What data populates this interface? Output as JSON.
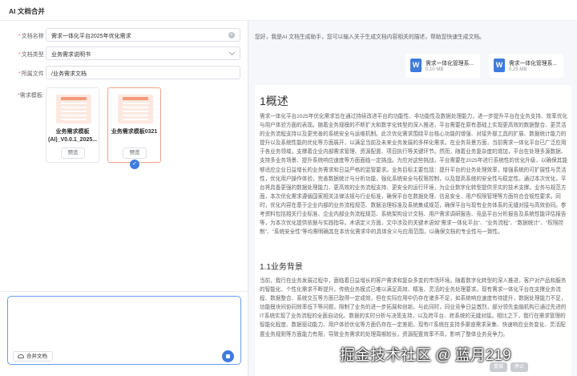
{
  "app": {
    "title": "AI 文档合并"
  },
  "form": {
    "doc_name": {
      "label": "文档名称",
      "value": "需求一体化平台2025年优化需求"
    },
    "doc_type": {
      "label": "文档类型",
      "value": "业务需求说明书"
    },
    "folder": {
      "label": "所属文件",
      "value": "/业务需求文档"
    },
    "template_label": "需求模板:"
  },
  "templates": [
    {
      "name": "业务需求模板(AI)_V0.0.1_2025...",
      "preview_label": "预览",
      "selected": false
    },
    {
      "name": "业务需求模板0321",
      "preview_label": "预览",
      "selected": true
    }
  ],
  "composer": {
    "merge_button": "合并文档"
  },
  "assistant": {
    "intro": "您好，我是AI 文档生成助手，您可以输入关于生成文档内容相关的描述，帮助您快速生成文档。",
    "files": [
      {
        "name": "需求一体化管理系...",
        "size": "0.10 MB",
        "icon": "word-icon"
      },
      {
        "name": "需求一体化管理系...",
        "size": "0.25 MB",
        "icon": "word-icon"
      }
    ]
  },
  "document": {
    "h1": "1概述",
    "p1": "需求一体化平台2025年优化需求旨在通过持续改进平台的功能性、非功能性及数据处理能力，进一步提升平台在业务支持、效率优化与用户体验方面的表现。随着业务规模的不断扩大和数字化转型的深入推进，平台需要在原有基础上实现更高效的数据整合、更灵活的业务流程支持以及更完善的系统安全与运维机制。此次优化需求围绕平台核心功能的增强、对接外部工具的扩展、数据统计能力的提升以及系统性能的优化等方面展开，以满足当前及未来业务发展的多样化需求。在业务背景方面，当前需求一体化平台已广泛应用于各业务领域，支撑着企业内部需求管理、资源配置、项目执行等关键环节。然而，随着业务复杂度的增加，平台在处理多源数据、支持多业务场景、提升系统响应速度等方面面临一定挑战。为应对这些挑战，平台需要在2025年进行系统性的优化升级，以确保其能够适应企业日益增长的业务需求和日益严格的监管要求。业务目标主要包括：提升平台的业务处理效率，增强系统的可扩展性与灵活性，优化用户操作体验，完善数据统计与分析功能，强化系统安全与权限控制，以及提高系统的安全性与稳定性。通过本次优化，平台将具备更强的数据处理能力、更高效的业务流程支持、更安全的运行环境，为企业数字化转型提供坚实的技术支撑。业务与规范方面，本次优化需求遵循国家相关法律法规与行业标准，确保平台在数据处理、信息安全、用户权限管理等方面符合合规性要求。同时，优化内容在基于企业内部的业务流程规范、数据治理标准及系统集成规范，确保平台与现有业务体系的无缝对接与高效协同。参考资料包括相关行业标准、企业内部业务流程规范、系统架构设计文档、用户需求调研报告、竞品平台分析报告及系统性能评估报告等，为本次优化提供依据与实践指导。术语定义方面，文中涉及的关键术语如\"需求一体化平台\"、\"业务流程\"、\"数据统计\"、\"权限控制\"、\"系统安全性\"等均需明确其在本优化需求中的具体含义与应用范围，以确保文档的专业性与一致性。",
    "h2": "1.1业务背景",
    "p2": "当前，我行在业务发展过程中，面临着日益增长的客户需求和复杂多变的市场环境。随着数字化转型的深入推进，客户对产品和服务的智能化、个性化需求不断提升，传统业务模式已难以满足高效、精准、灵活的业务处理要求。现有需求一体化平台在支撑业务流程、数据整合、系统交互等方面已取得一定成效，但在实际应用中仍存在诸多不足，如系统响应速度有待提升，数据处理能力不足，功能模块间协同效率低下等问题，限制了业务的进一步拓展和创新。与此同时，同业竞争日益激烈，部分领先金融机构已通过先进的IT系统实现了业务流程的全面自动化、数据的实时分析与决策支持，以及跨平台、跨系统的无缝对接。相比之下，我行在需求管理的智能化程度、数据驱动能力、用户体验优化等方面仍存在一定差距。现有IT系统在支持多渠道需求采集、快速响应业务变化、灵活配置业务规则等方面能力有限，导致业务需求的处理周期较长，资源配置效率不高，影响了整体业务竞争力。"
  },
  "footer": {
    "btn1": "重做",
    "btn2": "停止"
  },
  "watermark": "掘金技术社区 @ 蓝月219"
}
